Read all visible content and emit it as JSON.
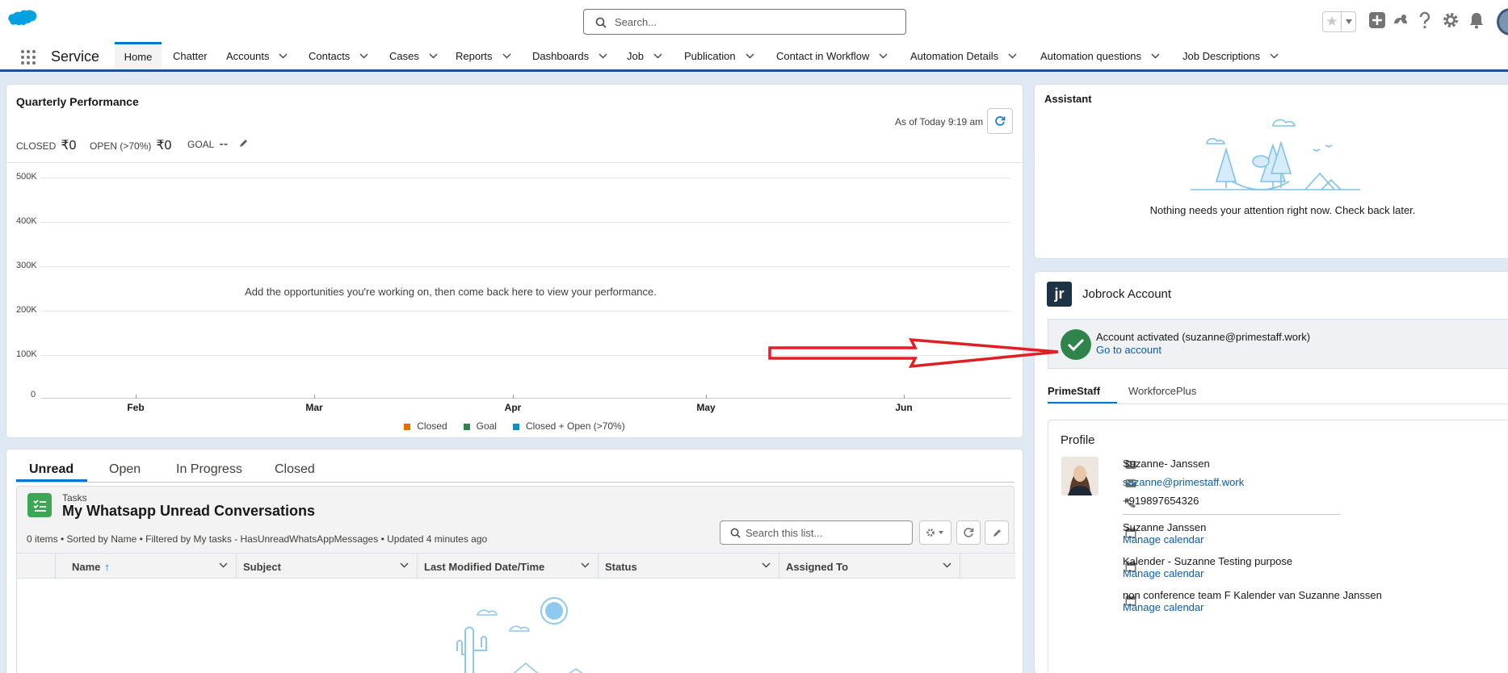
{
  "header": {
    "search_placeholder": "Search..."
  },
  "nav": {
    "app_name": "Service",
    "tabs": [
      {
        "label": "Home",
        "active": true
      },
      {
        "label": "Chatter"
      },
      {
        "label": "Accounts"
      },
      {
        "label": "Contacts"
      },
      {
        "label": "Cases"
      },
      {
        "label": "Reports"
      },
      {
        "label": "Dashboards"
      },
      {
        "label": "Job"
      },
      {
        "label": "Publication"
      },
      {
        "label": "Contact in Workflow"
      },
      {
        "label": "Automation Details"
      },
      {
        "label": "Automation questions"
      },
      {
        "label": "Job Descriptions"
      }
    ]
  },
  "performance": {
    "title": "Quarterly Performance",
    "as_of": "As of Today 9:19 am",
    "closed_label": "CLOSED",
    "closed_value": "₹0",
    "open_label": "OPEN (>70%)",
    "open_value": "₹0",
    "goal_label": "GOAL",
    "goal_value": "--",
    "empty_message": "Add the opportunities you're working on, then come back here to view your performance."
  },
  "chart_data": {
    "type": "line",
    "categories": [
      "Feb",
      "Mar",
      "Apr",
      "May",
      "Jun"
    ],
    "y_ticks": [
      "0",
      "100K",
      "200K",
      "300K",
      "400K",
      "500K"
    ],
    "ylim": [
      0,
      500000
    ],
    "series": [
      {
        "name": "Closed",
        "color": "#e07000",
        "values": []
      },
      {
        "name": "Goal",
        "color": "#2e844a",
        "values": []
      },
      {
        "name": "Closed + Open (>70%)",
        "color": "#0b8fcc",
        "values": []
      }
    ],
    "grid": true,
    "legend": "bottom"
  },
  "tasks": {
    "tabs": [
      "Unread",
      "Open",
      "In Progress",
      "Closed"
    ],
    "object_label": "Tasks",
    "list_title": "My Whatsapp Unread Conversations",
    "list_meta": "0 items • Sorted by Name • Filtered by My tasks - HasUnreadWhatsAppMessages • Updated 4 minutes ago",
    "search_placeholder": "Search this list...",
    "columns": [
      "Name",
      "Subject",
      "Last Modified Date/Time",
      "Status",
      "Assigned To"
    ]
  },
  "assistant": {
    "title": "Assistant",
    "message": "Nothing needs your attention right now. Check back later."
  },
  "jobrock": {
    "logo_text": "jr",
    "title": "Jobrock Account",
    "activated_text": "Account activated (suzanne@primestaff.work)",
    "go_to_account": "Go to account",
    "tabs": [
      "PrimeStaff",
      "WorkforcePlus"
    ],
    "profile_title": "Profile",
    "name": "Suzanne- Janssen",
    "email": "suzanne@primestaff.work",
    "phone": "+919897654326",
    "calendars": [
      {
        "name": "Suzanne Janssen",
        "link": "Manage calendar"
      },
      {
        "name": "Kalender - Suzanne Testing purpose",
        "link": "Manage calendar"
      },
      {
        "name": "non conference team F Kalender van Suzanne Janssen",
        "link": "Manage calendar"
      }
    ]
  },
  "colors": {
    "brand_blue": "#0176d3",
    "nav_bar_blue": "#1b5297",
    "success_green": "#2e844a",
    "annotation_red": "#e01e24"
  }
}
